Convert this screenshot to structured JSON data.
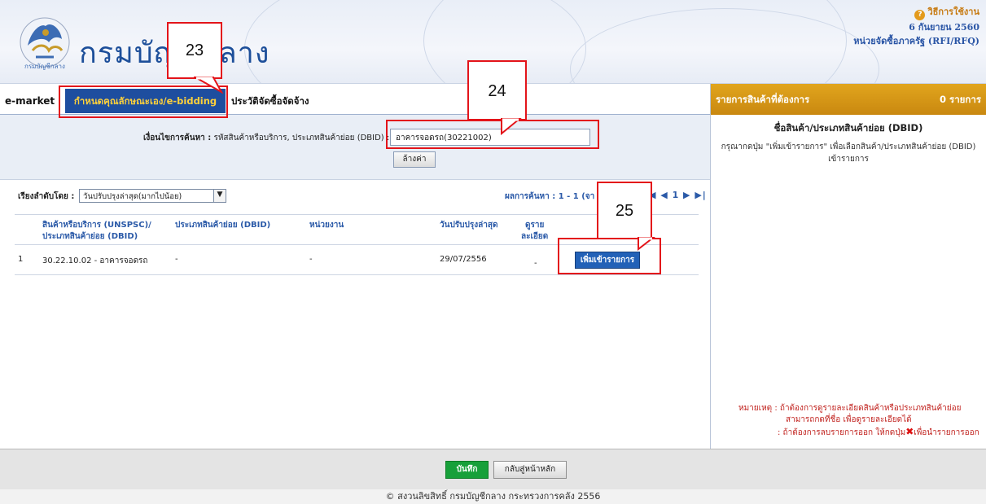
{
  "header": {
    "brand": "กรมบัญชีกลาง",
    "help_label": "วิธีการใช้งาน",
    "date": "6 กันยายน 2560",
    "unit": "หน่วยจัดซื้อภาครัฐ (RFI/RFQ)"
  },
  "tabs": {
    "emarket": "e-market",
    "spec": "กำหนดคุณลักษณะเอง/e-bidding",
    "history": "ประวัติจัดซื้อจัดจ้าง"
  },
  "search": {
    "label_bold": "เงื่อนไขการค้นหา :",
    "label_rest": "รหัสสินค้าหรือบริการ, ประเภทสินค้าย่อย (DBID) :",
    "value": "อาคารจอดรถ(30221002)",
    "clear_label": "ล้างค่า"
  },
  "results": {
    "sort_label": "เรียงลำดับโดย :",
    "sort_value": "วันปรับปรุงล่าสุด(มากไปน้อย)",
    "count_label": "ผลการค้นหา : 1 - 1 (จา",
    "pager": "◀ ◀ 1 ▶ ▶|",
    "columns": {
      "product": "สินค้าหรือบริการ (UNSPSC)/",
      "product2": "ประเภทสินค้าย่อย (DBID)",
      "subtype": "ประเภทสินค้าย่อย (DBID)",
      "agency": "หน่วยงาน",
      "updated": "วันปรับปรุงล่าสุด",
      "detail": "ดูราย",
      "detail2": "ละเอียด"
    },
    "rows": [
      {
        "no": "1",
        "product": "30.22.10.02 - อาคารจอดรถ",
        "subtype": "-",
        "agency": "-",
        "updated": "29/07/2556",
        "detail": "-",
        "action": "เพิ่มเข้ารายการ"
      }
    ]
  },
  "panel": {
    "title": "รายการสินค้าที่ต้องการ",
    "count": "0 รายการ",
    "subtitle": "ชื่อสินค้า/ประเภทสินค้าย่อย (DBID)",
    "hint1": "กรุณากดปุ่ม \"เพิ่มเข้ารายการ\" เพื่อเลือกสินค้า/ประเภทสินค้าย่อย (DBID)",
    "hint2": "เข้ารายการ",
    "note1": "หมายเหตุ : ถ้าต้องการดูรายละเอียดสินค้าหรือประเภทสินค้าย่อย",
    "note2": "สามารถกดที่ชื่อ เพื่อดูรายละเอียดได้",
    "note3a": ": ถ้าต้องการลบรายการออก ให้กดปุ่ม",
    "note3b": "เพื่อนำรายการออก"
  },
  "callouts": [
    "23",
    "24",
    "25"
  ],
  "footer": {
    "save": "บันทึก",
    "home": "กลับสู่หน้าหลัก",
    "copyright": "© สงวนลิขสิทธิ์ กรมบัญชีกลาง กระทรวงการคลัง 2556"
  },
  "colors": {
    "primary_blue": "#1e4e9f",
    "tab_text_yellow": "#ffd13b",
    "panel_orange": "#d6961a",
    "callout_red": "#e3141a",
    "save_green": "#17a03a"
  }
}
